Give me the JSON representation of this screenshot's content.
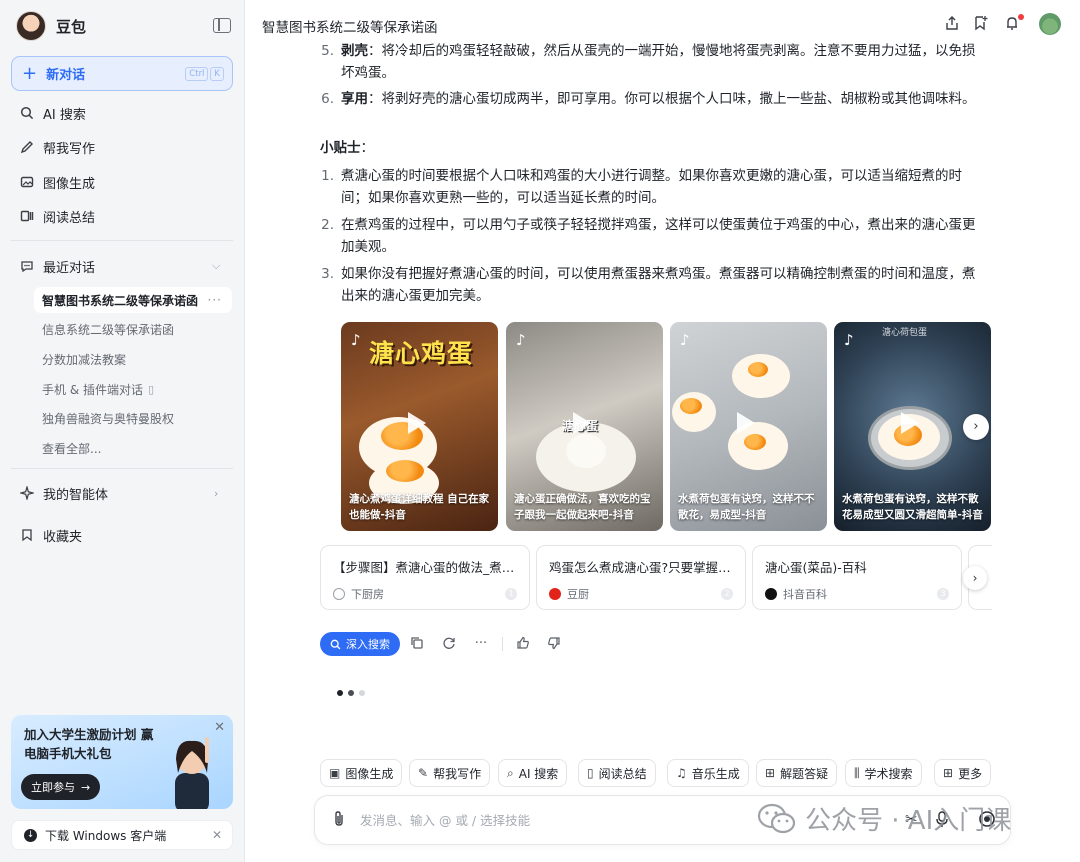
{
  "sidebar": {
    "brand": "豆包",
    "new_chat": {
      "label": "新对话",
      "shortcut": [
        "Ctrl",
        "K"
      ]
    },
    "nav": [
      {
        "label": "AI 搜索",
        "icon": "ai-search-icon"
      },
      {
        "label": "帮我写作",
        "icon": "pen-icon"
      },
      {
        "label": "图像生成",
        "icon": "image-icon"
      },
      {
        "label": "阅读总结",
        "icon": "read-summary-icon"
      }
    ],
    "recent": {
      "label": "最近对话",
      "items": [
        "智慧图书系统二级等保承诺函",
        "信息系统二级等保承诺函",
        "分数加减法教案",
        "手机 & 插件端对话",
        "独角兽融资与奥特曼股权",
        "查看全部..."
      ],
      "active_more": "···"
    },
    "agents": "我的智能体",
    "favorites": "收藏夹",
    "promo": {
      "title": "加入大学生激励计划 赢电脑手机大礼包",
      "button": "立即参与",
      "arrow": "→"
    },
    "download": "下载 Windows 客户端"
  },
  "header": {
    "title": "智慧图书系统二级等保承诺函"
  },
  "answer": {
    "steps": [
      {
        "num": "5.",
        "bold": "剥壳",
        "text": "：将冷却后的鸡蛋轻轻敲破，然后从蛋壳的一端开始，慢慢地将蛋壳剥离。注意不要用力过猛，以免损坏鸡蛋。"
      },
      {
        "num": "6.",
        "bold": "享用",
        "text": "：将剥好壳的溏心蛋切成两半，即可享用。你可以根据个人口味，撒上一些盐、胡椒粉或其他调味料。"
      }
    ],
    "tips_title": "小贴士",
    "tips_colon": "：",
    "tips": [
      {
        "num": "1.",
        "text": "煮溏心蛋的时间要根据个人口味和鸡蛋的大小进行调整。如果你喜欢更嫩的溏心蛋，可以适当缩短煮的时间；如果你喜欢更熟一些的，可以适当延长煮的时间。"
      },
      {
        "num": "2.",
        "text": "在煮鸡蛋的过程中，可以用勺子或筷子轻轻搅拌鸡蛋，这样可以使蛋黄位于鸡蛋的中心，煮出来的溏心蛋更加美观。"
      },
      {
        "num": "3.",
        "text": "如果你没有把握好煮溏心蛋的时间，可以使用煮蛋器来煮鸡蛋。煮蛋器可以精确控制煮蛋的时间和温度，煮出来的溏心蛋更加完美。"
      }
    ]
  },
  "videos": [
    {
      "overlay": "溏心鸡蛋",
      "caption": "溏心煮鸡蛋详细教程 自己在家也能做-抖音"
    },
    {
      "overlay": "溏心蛋",
      "caption": "溏心蛋正确做法，喜欢吃的宝子跟我一起做起来吧-抖音"
    },
    {
      "overlay": "",
      "caption": "水煮荷包蛋有诀窍，这样不不散花，易成型-抖音"
    },
    {
      "overlay": "溏心荷包蛋",
      "caption": "水煮荷包蛋有诀窍，这样不散花易成型又圆又滑超简单-抖音"
    }
  ],
  "refs": [
    {
      "title": "【步骤图】煮溏心蛋的做法_煮溏心蛋的做法步骤",
      "source": "下厨房",
      "num": "1"
    },
    {
      "title": "鸡蛋怎么煮成溏心蛋?只要掌握这几点",
      "source": "豆厨",
      "num": "2"
    },
    {
      "title": "溏心蛋(菜品)-百科",
      "source": "抖音百科",
      "num": "3"
    }
  ],
  "actions": {
    "deep_search": "深入搜索"
  },
  "skills": [
    {
      "label": "图像生成",
      "icon": "image-icon"
    },
    {
      "label": "帮我写作",
      "icon": "pen-icon"
    },
    {
      "label": "AI 搜索",
      "icon": "ai-search-icon"
    },
    {
      "label": "阅读总结",
      "icon": "read-summary-icon"
    },
    {
      "label": "音乐生成",
      "icon": "music-icon"
    },
    {
      "label": "解题答疑",
      "icon": "solve-icon"
    },
    {
      "label": "学术搜索",
      "icon": "academic-icon"
    },
    {
      "label": "更多",
      "icon": "more-grid-icon"
    }
  ],
  "composer": {
    "placeholder": "发消息、输入 @ 或 / 选择技能"
  },
  "watermark": {
    "text": "公众号 · AI入门课"
  },
  "colors": {
    "accent": "#2e6cf6",
    "accent_bg": "#e7efff",
    "sidebar_bg": "#f4f5f7",
    "notify": "#f23d3d"
  }
}
